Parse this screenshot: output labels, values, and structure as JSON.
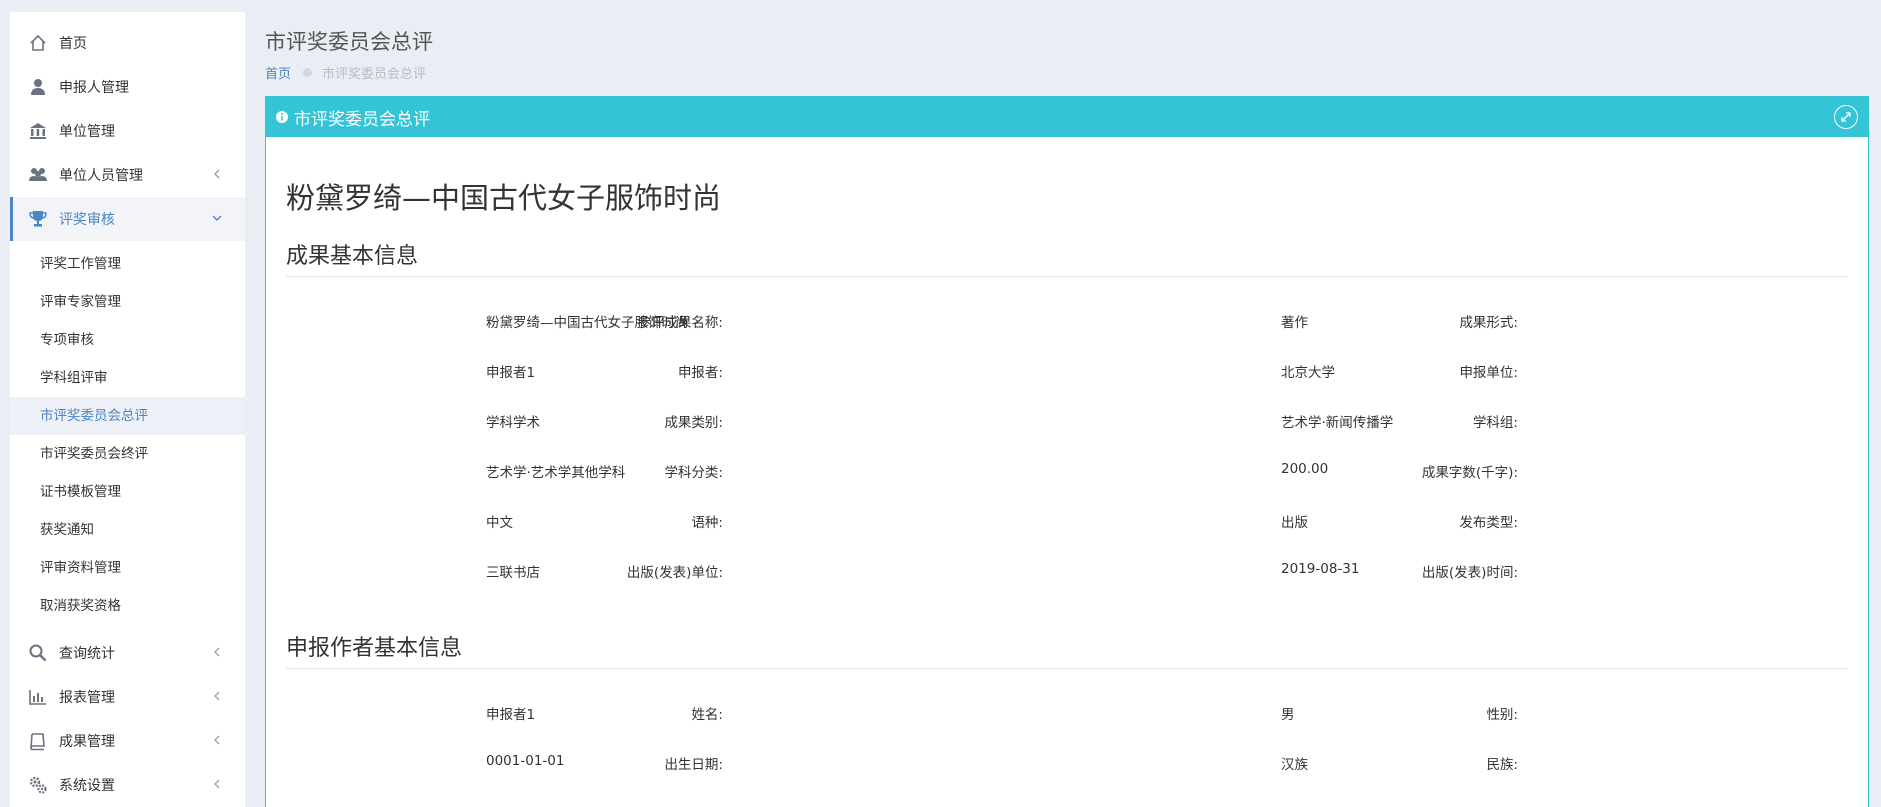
{
  "sidebar": {
    "items": [
      {
        "label": "首页",
        "icon": "home-icon"
      },
      {
        "label": "申报人管理",
        "icon": "user-icon"
      },
      {
        "label": "单位管理",
        "icon": "bank-icon"
      },
      {
        "label": "单位人员管理",
        "icon": "users-icon"
      },
      {
        "label": "评奖审核",
        "icon": "trophy-icon"
      }
    ],
    "sub_items": [
      {
        "label": "评奖工作管理"
      },
      {
        "label": "评审专家管理"
      },
      {
        "label": "专项审核"
      },
      {
        "label": "学科组评审"
      },
      {
        "label": "市评奖委员会总评"
      },
      {
        "label": "市评奖委员会终评"
      },
      {
        "label": "证书模板管理"
      },
      {
        "label": "获奖通知"
      },
      {
        "label": "评审资料管理"
      },
      {
        "label": "取消获奖资格"
      }
    ],
    "bottom_items": [
      {
        "label": "查询统计",
        "icon": "search-icon"
      },
      {
        "label": "报表管理",
        "icon": "bar-chart-icon"
      },
      {
        "label": "成果管理",
        "icon": "book-icon"
      },
      {
        "label": "系统设置",
        "icon": "gears-icon"
      }
    ],
    "accent_color": "#4a86c6"
  },
  "header": {
    "title": "市评奖委员会总评",
    "breadcrumb": {
      "home": "首页",
      "current": "市评奖委员会总评"
    }
  },
  "panel": {
    "title": "市评奖委员会总评",
    "header_color": "#35c3d6",
    "doc_title": "粉黛罗绮—中国古代女子服饰时尚",
    "section1": {
      "title": "成果基本信息",
      "rows": [
        {
          "l_label": "参评成果名称:",
          "l_value": "粉黛罗绮—中国古代女子服饰时尚",
          "r_label": "成果形式:",
          "r_value": "著作"
        },
        {
          "l_label": "申报者:",
          "l_value": "申报者1",
          "r_label": "申报单位:",
          "r_value": "北京大学"
        },
        {
          "l_label": "成果类别:",
          "l_value": "学科学术",
          "r_label": "学科组:",
          "r_value": "艺术学·新闻传播学"
        },
        {
          "l_label": "学科分类:",
          "l_value": "艺术学·艺术学其他学科",
          "r_label": "成果字数(千字):",
          "r_value": "200.00"
        },
        {
          "l_label": "语种:",
          "l_value": "中文",
          "r_label": "发布类型:",
          "r_value": "出版"
        },
        {
          "l_label": "出版(发表)单位:",
          "l_value": "三联书店",
          "r_label": "出版(发表)时间:",
          "r_value": "2019-08-31"
        }
      ]
    },
    "section2": {
      "title": "申报作者基本信息",
      "rows": [
        {
          "l_label": "姓名:",
          "l_value": "申报者1",
          "r_label": "性别:",
          "r_value": "男"
        },
        {
          "l_label": "出生日期:",
          "l_value": "0001-01-01",
          "r_label": "民族:",
          "r_value": "汉族"
        }
      ]
    }
  }
}
